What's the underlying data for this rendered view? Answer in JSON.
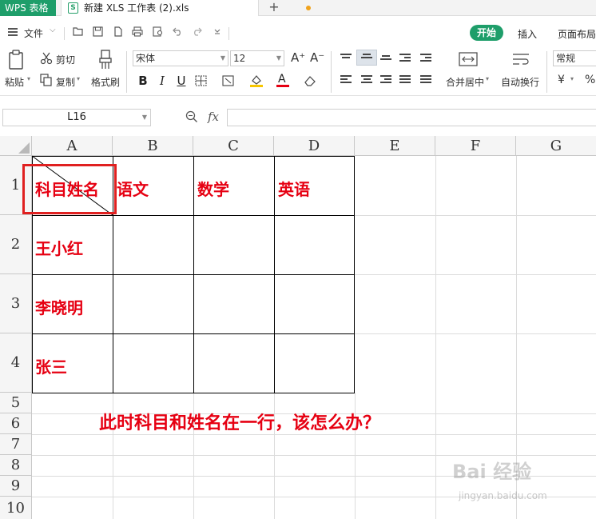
{
  "titlebar": {
    "app_name": "WPS 表格",
    "doc_icon_letter": "S",
    "doc_title": "新建 XLS 工作表 (2).xls",
    "new_tab": "+"
  },
  "menubar": {
    "file_label": "文件",
    "file_chevron": "⌵",
    "tabs": [
      "开始",
      "插入",
      "页面布局"
    ]
  },
  "ribbon": {
    "paste": "粘贴",
    "cut": "剪切",
    "copy": "复制",
    "format_painter": "格式刷",
    "font_name": "宋体",
    "font_size": "12",
    "grow_font": "A⁺",
    "shrink_font": "A⁻",
    "bold": "B",
    "italic": "I",
    "underline": "U",
    "font_color_letter": "A",
    "merge_center": "合并居中",
    "wrap_text": "自动换行",
    "number_format": "常规",
    "currency": "¥",
    "percent": "%"
  },
  "formula_bar": {
    "cell_ref": "L16",
    "fx": "fx",
    "value": ""
  },
  "grid": {
    "columns": [
      "A",
      "B",
      "C",
      "D",
      "E",
      "F",
      "G"
    ],
    "rows": [
      "1",
      "2",
      "3",
      "4",
      "5",
      "6",
      "7",
      "8",
      "9",
      "10"
    ],
    "cells": {
      "A1": "科目姓名",
      "B1": "语文",
      "C1": "数学",
      "D1": "英语",
      "A2": "王小红",
      "A3": "李晓明",
      "A4": "张三"
    },
    "annotation": "此时科目和姓名在一行，该怎么办？",
    "text_color": "#e60012",
    "highlight_color": "#e02020"
  },
  "watermark": {
    "main": "Bai 经验",
    "sub": "jingyan.baidu.com"
  },
  "colors": {
    "accent": "#1e9e6a",
    "modified_dot": "#f0a21c"
  }
}
